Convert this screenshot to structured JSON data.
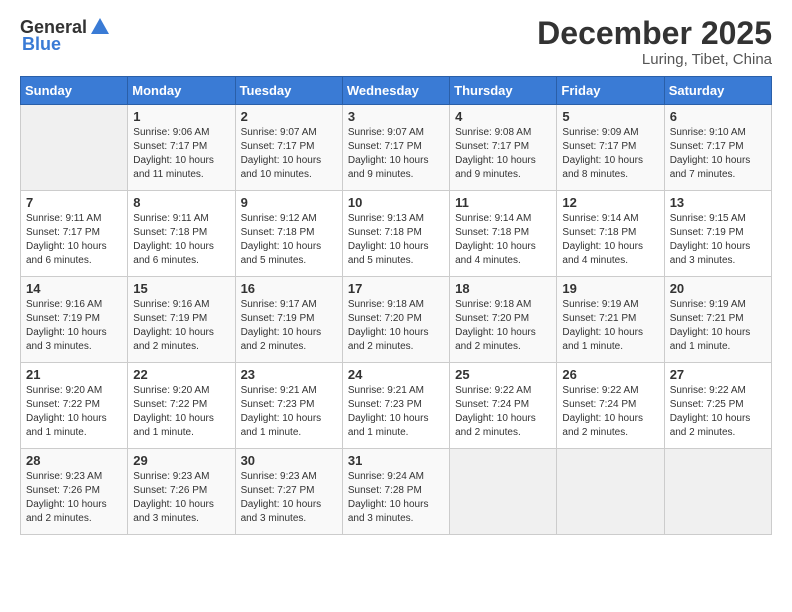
{
  "logo": {
    "general": "General",
    "blue": "Blue"
  },
  "title": "December 2025",
  "location": "Luring, Tibet, China",
  "days_of_week": [
    "Sunday",
    "Monday",
    "Tuesday",
    "Wednesday",
    "Thursday",
    "Friday",
    "Saturday"
  ],
  "weeks": [
    [
      {
        "day": "",
        "info": ""
      },
      {
        "day": "1",
        "info": "Sunrise: 9:06 AM\nSunset: 7:17 PM\nDaylight: 10 hours\nand 11 minutes."
      },
      {
        "day": "2",
        "info": "Sunrise: 9:07 AM\nSunset: 7:17 PM\nDaylight: 10 hours\nand 10 minutes."
      },
      {
        "day": "3",
        "info": "Sunrise: 9:07 AM\nSunset: 7:17 PM\nDaylight: 10 hours\nand 9 minutes."
      },
      {
        "day": "4",
        "info": "Sunrise: 9:08 AM\nSunset: 7:17 PM\nDaylight: 10 hours\nand 9 minutes."
      },
      {
        "day": "5",
        "info": "Sunrise: 9:09 AM\nSunset: 7:17 PM\nDaylight: 10 hours\nand 8 minutes."
      },
      {
        "day": "6",
        "info": "Sunrise: 9:10 AM\nSunset: 7:17 PM\nDaylight: 10 hours\nand 7 minutes."
      }
    ],
    [
      {
        "day": "7",
        "info": "Sunrise: 9:11 AM\nSunset: 7:17 PM\nDaylight: 10 hours\nand 6 minutes."
      },
      {
        "day": "8",
        "info": "Sunrise: 9:11 AM\nSunset: 7:18 PM\nDaylight: 10 hours\nand 6 minutes."
      },
      {
        "day": "9",
        "info": "Sunrise: 9:12 AM\nSunset: 7:18 PM\nDaylight: 10 hours\nand 5 minutes."
      },
      {
        "day": "10",
        "info": "Sunrise: 9:13 AM\nSunset: 7:18 PM\nDaylight: 10 hours\nand 5 minutes."
      },
      {
        "day": "11",
        "info": "Sunrise: 9:14 AM\nSunset: 7:18 PM\nDaylight: 10 hours\nand 4 minutes."
      },
      {
        "day": "12",
        "info": "Sunrise: 9:14 AM\nSunset: 7:18 PM\nDaylight: 10 hours\nand 4 minutes."
      },
      {
        "day": "13",
        "info": "Sunrise: 9:15 AM\nSunset: 7:19 PM\nDaylight: 10 hours\nand 3 minutes."
      }
    ],
    [
      {
        "day": "14",
        "info": "Sunrise: 9:16 AM\nSunset: 7:19 PM\nDaylight: 10 hours\nand 3 minutes."
      },
      {
        "day": "15",
        "info": "Sunrise: 9:16 AM\nSunset: 7:19 PM\nDaylight: 10 hours\nand 2 minutes."
      },
      {
        "day": "16",
        "info": "Sunrise: 9:17 AM\nSunset: 7:19 PM\nDaylight: 10 hours\nand 2 minutes."
      },
      {
        "day": "17",
        "info": "Sunrise: 9:18 AM\nSunset: 7:20 PM\nDaylight: 10 hours\nand 2 minutes."
      },
      {
        "day": "18",
        "info": "Sunrise: 9:18 AM\nSunset: 7:20 PM\nDaylight: 10 hours\nand 2 minutes."
      },
      {
        "day": "19",
        "info": "Sunrise: 9:19 AM\nSunset: 7:21 PM\nDaylight: 10 hours\nand 1 minute."
      },
      {
        "day": "20",
        "info": "Sunrise: 9:19 AM\nSunset: 7:21 PM\nDaylight: 10 hours\nand 1 minute."
      }
    ],
    [
      {
        "day": "21",
        "info": "Sunrise: 9:20 AM\nSunset: 7:22 PM\nDaylight: 10 hours\nand 1 minute."
      },
      {
        "day": "22",
        "info": "Sunrise: 9:20 AM\nSunset: 7:22 PM\nDaylight: 10 hours\nand 1 minute."
      },
      {
        "day": "23",
        "info": "Sunrise: 9:21 AM\nSunset: 7:23 PM\nDaylight: 10 hours\nand 1 minute."
      },
      {
        "day": "24",
        "info": "Sunrise: 9:21 AM\nSunset: 7:23 PM\nDaylight: 10 hours\nand 1 minute."
      },
      {
        "day": "25",
        "info": "Sunrise: 9:22 AM\nSunset: 7:24 PM\nDaylight: 10 hours\nand 2 minutes."
      },
      {
        "day": "26",
        "info": "Sunrise: 9:22 AM\nSunset: 7:24 PM\nDaylight: 10 hours\nand 2 minutes."
      },
      {
        "day": "27",
        "info": "Sunrise: 9:22 AM\nSunset: 7:25 PM\nDaylight: 10 hours\nand 2 minutes."
      }
    ],
    [
      {
        "day": "28",
        "info": "Sunrise: 9:23 AM\nSunset: 7:26 PM\nDaylight: 10 hours\nand 2 minutes."
      },
      {
        "day": "29",
        "info": "Sunrise: 9:23 AM\nSunset: 7:26 PM\nDaylight: 10 hours\nand 3 minutes."
      },
      {
        "day": "30",
        "info": "Sunrise: 9:23 AM\nSunset: 7:27 PM\nDaylight: 10 hours\nand 3 minutes."
      },
      {
        "day": "31",
        "info": "Sunrise: 9:24 AM\nSunset: 7:28 PM\nDaylight: 10 hours\nand 3 minutes."
      },
      {
        "day": "",
        "info": ""
      },
      {
        "day": "",
        "info": ""
      },
      {
        "day": "",
        "info": ""
      }
    ]
  ]
}
